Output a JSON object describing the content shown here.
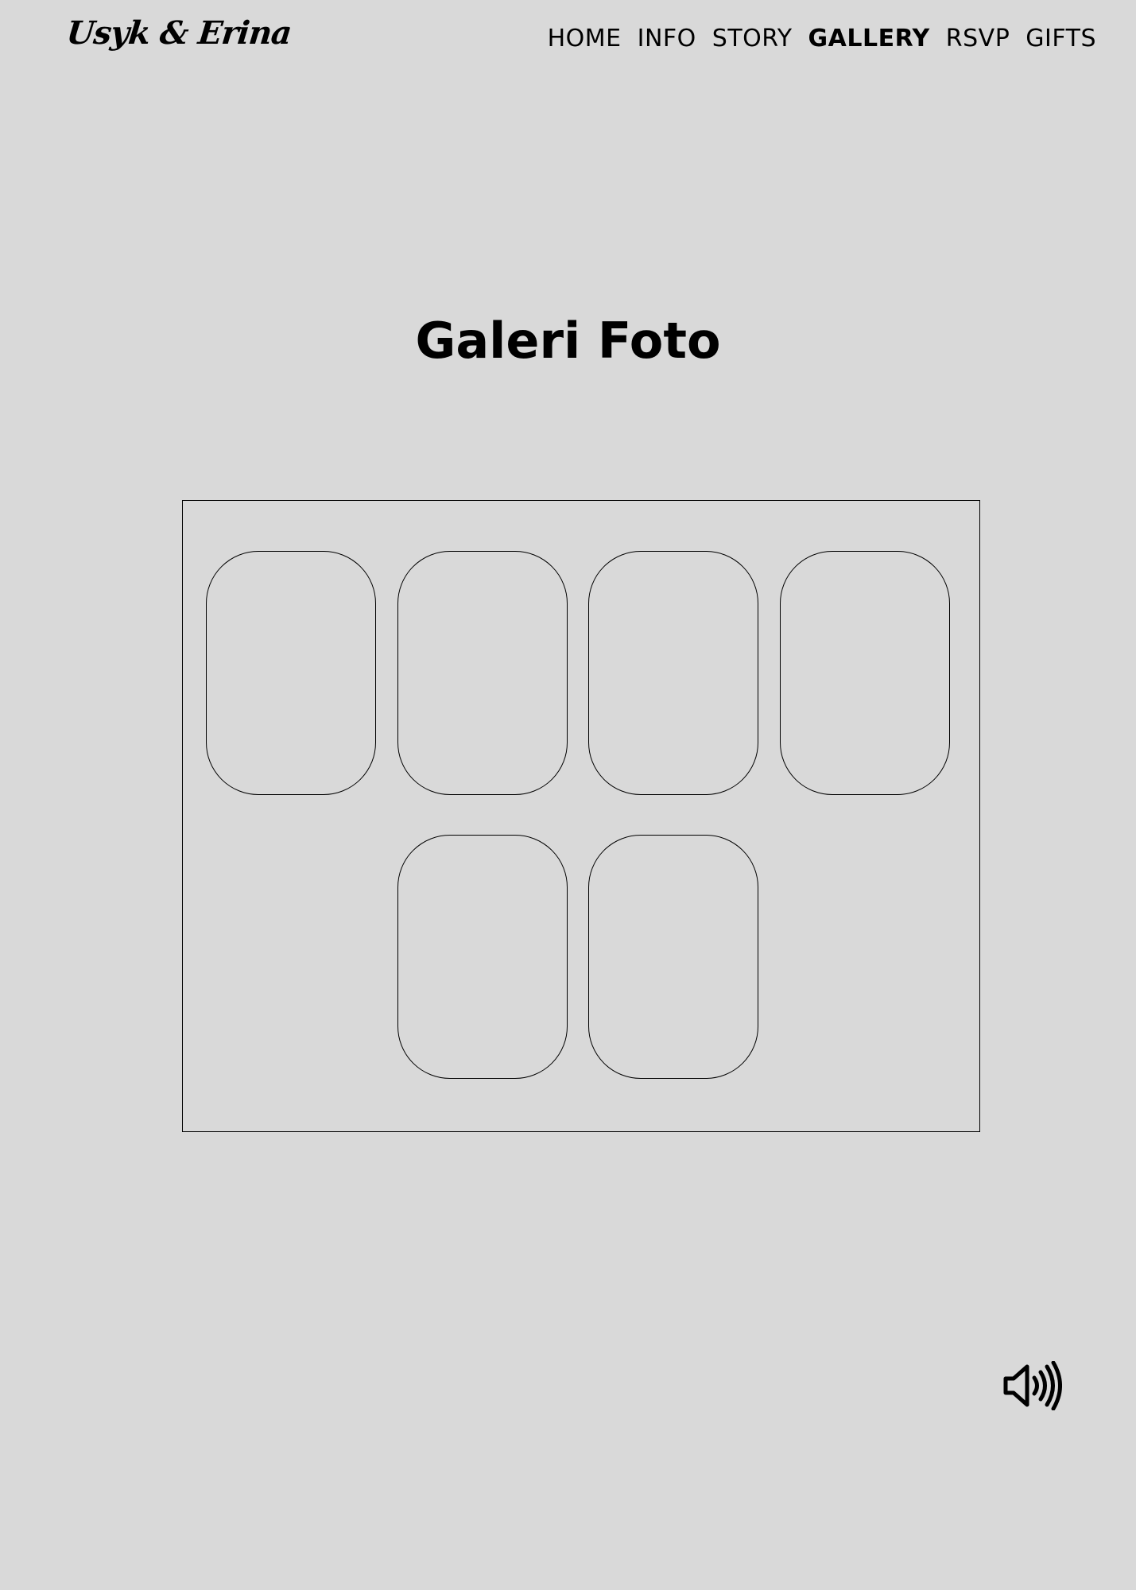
{
  "header": {
    "logo_text": "Usyk & Erina",
    "nav": [
      {
        "label": "HOME",
        "active": false
      },
      {
        "label": "INFO",
        "active": false
      },
      {
        "label": "STORY",
        "active": false
      },
      {
        "label": "GALLERY",
        "active": true
      },
      {
        "label": "RSVP",
        "active": false
      },
      {
        "label": "GIFTS",
        "active": false
      }
    ]
  },
  "main": {
    "title": "Galeri Foto",
    "gallery": {
      "photos": [
        {
          "label": ""
        },
        {
          "label": ""
        },
        {
          "label": ""
        },
        {
          "label": ""
        },
        {
          "label": ""
        },
        {
          "label": ""
        }
      ]
    }
  },
  "controls": {
    "sound_icon": "speaker-volume-icon"
  },
  "colors": {
    "background": "#d9d9d9",
    "text": "#000000"
  }
}
